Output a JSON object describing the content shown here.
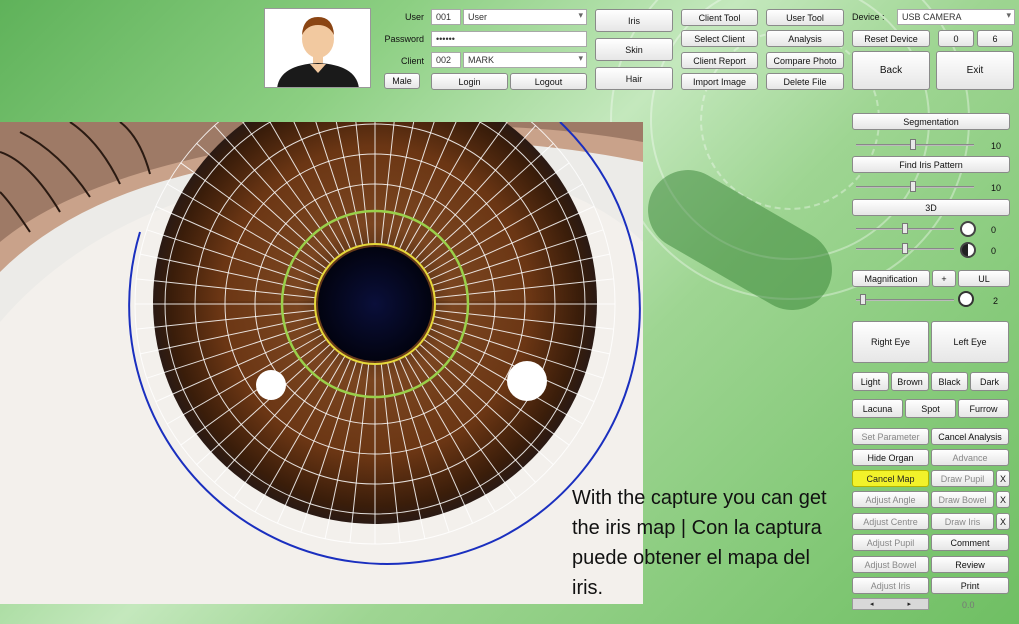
{
  "login": {
    "user_label": "User",
    "user_id": "001",
    "user_name": "User",
    "password_label": "Password",
    "password_value": "••••••",
    "client_label": "Client",
    "client_id": "002",
    "client_name": "MARK",
    "gender": "Male",
    "login_button": "Login",
    "logout_button": "Logout"
  },
  "modes": {
    "iris": "Iris",
    "skin": "Skin",
    "hair": "Hair"
  },
  "tools": {
    "client_tool": "Client Tool",
    "select_client": "Select Client",
    "client_report": "Client Report",
    "import_image": "Import Image",
    "user_tool": "User Tool",
    "analysis": "Analysis",
    "compare_photo": "Compare Photo",
    "delete_file": "Delete File"
  },
  "device": {
    "label": "Device :",
    "value": "USB CAMERA",
    "reset": "Reset Device",
    "n1": "0",
    "n2": "6",
    "back": "Back",
    "exit": "Exit"
  },
  "panel": {
    "segmentation": "Segmentation",
    "seg_value": "10",
    "find_pattern": "Find Iris Pattern",
    "find_value": "10",
    "three_d": "3D",
    "brightness_value": "0",
    "contrast_value": "0",
    "magnification": "Magnification",
    "plus": "+",
    "ul": "UL",
    "mag_value": "2",
    "right_eye": "Right Eye",
    "left_eye": "Left Eye",
    "light": "Light",
    "brown": "Brown",
    "black": "Black",
    "dark": "Dark",
    "lacuna": "Lacuna",
    "spot": "Spot",
    "furrow": "Furrow",
    "set_parameter": "Set Parameter",
    "cancel_analysis": "Cancel Analysis",
    "hide_organ": "Hide Organ",
    "advance": "Advance",
    "cancel_map": "Cancel Map",
    "draw_pupil": "Draw Pupil",
    "adjust_angle": "Adjust Angle",
    "draw_bowel": "Draw Bowel",
    "adjust_centre": "Adjust Centre",
    "draw_iris": "Draw Iris",
    "adjust_pupil": "Adjust Pupil",
    "comment": "Comment",
    "adjust_bowel": "Adjust Bowel",
    "review": "Review",
    "adjust_iris": "Adjust Iris",
    "print": "Print",
    "x": "X",
    "scroll_value": "0.0"
  },
  "caption": "With the capture you can get the iris map | Con la captura puede obtener el mapa del iris."
}
